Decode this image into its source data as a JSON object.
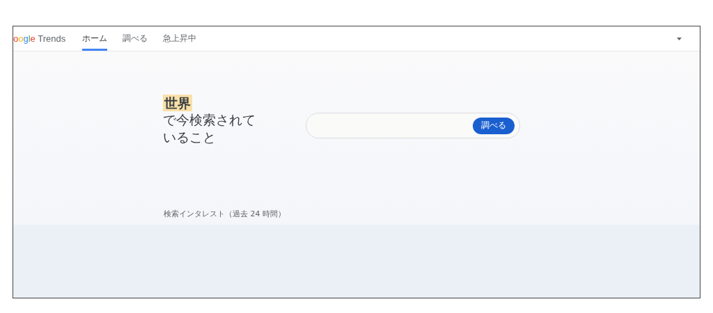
{
  "header": {
    "logo": "oogle Trends",
    "tabs": [
      {
        "label": "ホーム",
        "selected": true
      },
      {
        "label": "調べる",
        "selected": false
      },
      {
        "label": "急上昇中",
        "selected": false
      }
    ]
  },
  "hero": {
    "highlight": "世界",
    "headline": "で今検索されていること"
  },
  "search": {
    "button": "調べる"
  },
  "section_label": "検索インタレスト（過去 24 時間）"
}
